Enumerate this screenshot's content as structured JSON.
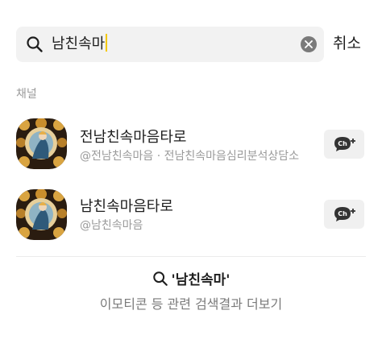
{
  "search": {
    "value": "남친속마",
    "cancel_label": "취소"
  },
  "section": {
    "label": "채널"
  },
  "channels": [
    {
      "name": "전남친속마음타로",
      "subtitle": "@전남친속마음 · 전남친속마음심리분석상담소",
      "add_label": "Ch+"
    },
    {
      "name": "남친속마음타로",
      "subtitle": "@남친속마음",
      "add_label": "Ch+"
    }
  ],
  "emoticon": {
    "query": "'남친속마'",
    "more_label": "이모티콘 등 관련 검색결과 더보기"
  },
  "icons": {
    "search": "search-icon",
    "clear": "clear-icon",
    "add_channel": "add-channel-icon"
  },
  "colors": {
    "caret": "#f5c800",
    "search_bg": "#f2f2f2",
    "secondary_text": "#9a9a9a"
  }
}
